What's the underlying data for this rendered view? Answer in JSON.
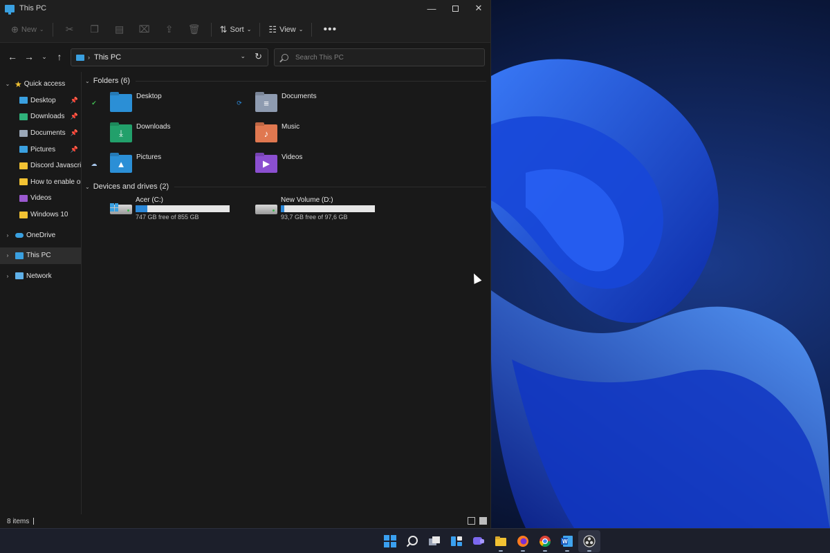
{
  "window": {
    "title": "This PC",
    "controls": {
      "minimize": "—",
      "maximize": "",
      "close": "✕"
    }
  },
  "command_bar": {
    "new_label": "New",
    "sort_label": "Sort",
    "view_label": "View",
    "more_label": "•••"
  },
  "nav": {
    "back": "←",
    "forward": "→",
    "recent": "⌄",
    "up": "↑",
    "breadcrumb": "This PC",
    "refresh": "↻",
    "dropdown": "⌄"
  },
  "search": {
    "placeholder": "Search This PC",
    "value": ""
  },
  "sidebar": {
    "quick_access": "Quick access",
    "pinned": [
      {
        "label": "Desktop",
        "icon": "desktop-folder-icon",
        "color": "#3aa0e0",
        "pinned": true
      },
      {
        "label": "Downloads",
        "icon": "downloads-folder-icon",
        "color": "#2fb37b",
        "pinned": true
      },
      {
        "label": "Documents",
        "icon": "documents-folder-icon",
        "color": "#9aa7b8",
        "pinned": true
      },
      {
        "label": "Pictures",
        "icon": "pictures-folder-icon",
        "color": "#3aa0e0",
        "pinned": true
      },
      {
        "label": "Discord Javascript",
        "icon": "folder-icon",
        "color": "#f2c233",
        "pinned": false
      },
      {
        "label": "How to enable or d",
        "icon": "folder-icon",
        "color": "#f2c233",
        "pinned": false
      },
      {
        "label": "Videos",
        "icon": "videos-folder-icon",
        "color": "#9b59d0",
        "pinned": false
      },
      {
        "label": "Windows 10",
        "icon": "folder-icon",
        "color": "#f2c233",
        "pinned": false
      }
    ],
    "onedrive": "OneDrive",
    "this_pc": "This PC",
    "network": "Network"
  },
  "content": {
    "folders_header": "Folders (6)",
    "folders": [
      {
        "name": "Desktop",
        "color": "#2b8fd6",
        "glyph": "",
        "status": "synced-icon",
        "status_glyph": "✔",
        "status_color": "#3fb950"
      },
      {
        "name": "Documents",
        "color": "#8e9bb0",
        "glyph": "≡",
        "status": "sync-pending-icon",
        "status_glyph": "⟳",
        "status_color": "#2b88d8"
      },
      {
        "name": "Downloads",
        "color": "#22a06b",
        "glyph": "⤓",
        "status": "",
        "status_glyph": "",
        "status_color": ""
      },
      {
        "name": "Music",
        "color": "#e07850",
        "glyph": "♪",
        "status": "",
        "status_glyph": "",
        "status_color": ""
      },
      {
        "name": "Pictures",
        "color": "#2b8fd6",
        "glyph": "▲",
        "status": "cloud-icon",
        "status_glyph": "☁",
        "status_color": "#a9c8ee"
      },
      {
        "name": "Videos",
        "color": "#8b4fd0",
        "glyph": "▶",
        "status": "",
        "status_glyph": "",
        "status_color": ""
      }
    ],
    "drives_header": "Devices and drives (2)",
    "drives": [
      {
        "name": "Acer (C:)",
        "free_text": "747 GB free of 855 GB",
        "used_fraction": 0.126,
        "system": true
      },
      {
        "name": "New Volume (D:)",
        "free_text": "93,7 GB free of 97,6 GB",
        "used_fraction": 0.04,
        "system": false
      }
    ]
  },
  "status_bar": {
    "item_count": "8 items"
  },
  "taskbar": {
    "apps": [
      {
        "name": "start-icon",
        "active": false,
        "running": false
      },
      {
        "name": "search-icon",
        "active": false,
        "running": false
      },
      {
        "name": "task-view-icon",
        "active": false,
        "running": false
      },
      {
        "name": "widgets-icon",
        "active": false,
        "running": false
      },
      {
        "name": "chat-icon",
        "active": false,
        "running": false
      },
      {
        "name": "file-explorer-icon",
        "active": false,
        "running": true
      },
      {
        "name": "firefox-icon",
        "active": false,
        "running": true
      },
      {
        "name": "chrome-icon",
        "active": false,
        "running": true
      },
      {
        "name": "word-icon",
        "active": false,
        "running": true
      },
      {
        "name": "obs-icon",
        "active": true,
        "running": true
      }
    ]
  },
  "colors": {
    "accent": "#2b88d8",
    "window_bg": "#191919",
    "taskbar_bg": "#1c1f2b"
  }
}
